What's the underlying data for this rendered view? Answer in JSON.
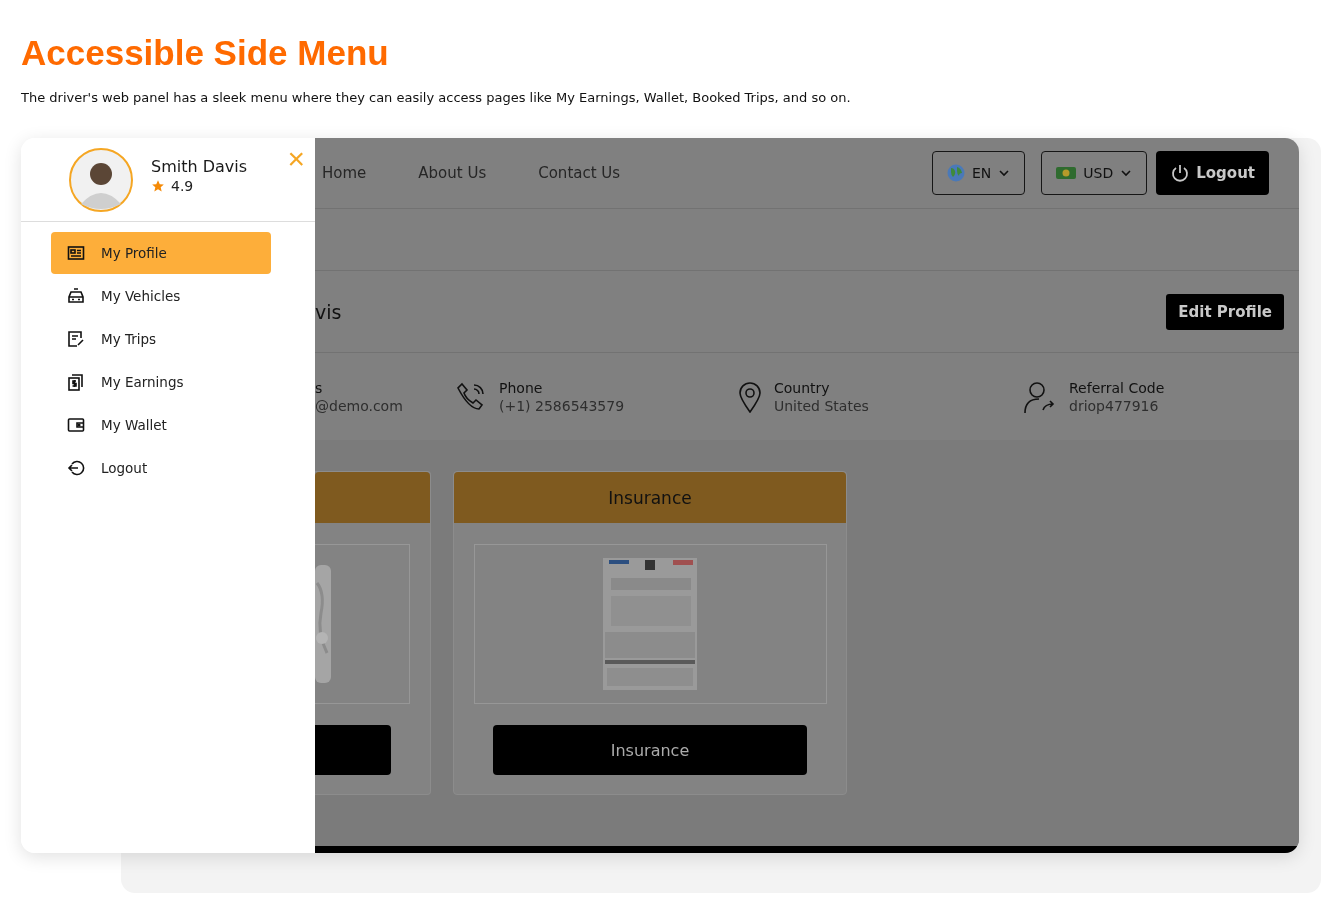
{
  "heading": "Accessible Side Menu",
  "description": "The driver's web panel has a sleek menu where they can easily access pages like My Earnings, Wallet, Booked Trips, and so on.",
  "side_menu": {
    "user_name": "Smith Davis",
    "rating": "4.9",
    "close": "×",
    "items": [
      {
        "label": "My Profile",
        "selected": true
      },
      {
        "label": "My Vehicles",
        "selected": false
      },
      {
        "label": "My Trips",
        "selected": false
      },
      {
        "label": "My Earnings",
        "selected": false
      },
      {
        "label": "My Wallet",
        "selected": false
      },
      {
        "label": "Logout",
        "selected": false
      }
    ]
  },
  "navbar": {
    "links": [
      "Home",
      "About Us",
      "Contact Us"
    ],
    "language": "EN",
    "currency": "USD",
    "logout": "Logout"
  },
  "profile": {
    "name_fragment": "vis",
    "edit_button": "Edit Profile",
    "details": [
      {
        "kind": "email",
        "label": "s",
        "value": "@demo.com"
      },
      {
        "kind": "phone",
        "label": "Phone",
        "value": "(+1) 2586543579"
      },
      {
        "kind": "country",
        "label": "Country",
        "value": "United States"
      },
      {
        "kind": "referral",
        "label": "Referral Code",
        "value": "driop477916"
      }
    ]
  },
  "documents": [
    {
      "kind": "cut"
    },
    {
      "kind": "card",
      "title": "Insurance",
      "button": "Insurance"
    }
  ]
}
